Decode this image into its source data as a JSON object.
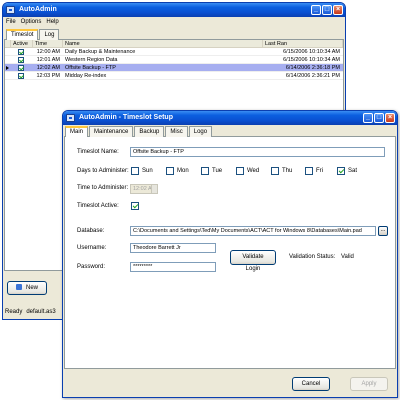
{
  "main_window": {
    "title": "AutoAdmin",
    "menu": [
      "File",
      "Options",
      "Help"
    ],
    "tabs": [
      "Timeslot",
      "Log"
    ],
    "grid": {
      "headers": [
        "Active",
        "Time",
        "Name",
        "Last Ran"
      ],
      "rows": [
        {
          "active": true,
          "time": "12:00 AM",
          "name": "Daily Backup & Maintenance",
          "last_ran": "6/15/2006 10:10:34 AM",
          "selected": false
        },
        {
          "active": true,
          "time": "12:01 AM",
          "name": "Western Region Data",
          "last_ran": "6/15/2006 10:10:34 AM",
          "selected": false
        },
        {
          "active": true,
          "time": "12:02 AM",
          "name": "Offsite Backup - FTP",
          "last_ran": "6/14/2006 2:36:18 PM",
          "selected": true
        },
        {
          "active": true,
          "time": "12:03 PM",
          "name": "Midday Re-index",
          "last_ran": "6/14/2006 2:36:21 PM",
          "selected": false
        }
      ]
    },
    "new_button": "New",
    "status": {
      "label": "Ready",
      "file": "default.as3"
    }
  },
  "setup_dialog": {
    "title": "AutoAdmin - Timeslot Setup",
    "tabs": [
      "Main",
      "Maintenance",
      "Backup",
      "Misc",
      "Logo"
    ],
    "timeslot_name_label": "Timeslot Name:",
    "timeslot_name": "Offsite Backup - FTP",
    "days_label": "Days to Administer:",
    "days": [
      {
        "label": "Sun",
        "checked": false
      },
      {
        "label": "Mon",
        "checked": false
      },
      {
        "label": "Tue",
        "checked": false
      },
      {
        "label": "Wed",
        "checked": false
      },
      {
        "label": "Thu",
        "checked": false
      },
      {
        "label": "Fri",
        "checked": false
      },
      {
        "label": "Sat",
        "checked": true
      }
    ],
    "time_label": "Time to Administer:",
    "time_value": "12:02 AM",
    "active_label": "Timeslot Active:",
    "active_checked": true,
    "database_label": "Database:",
    "database_value": "C:\\Documents and Settings\\Ted\\My Documents\\ACT\\ACT for Windows 8\\Databases\\Main.pad",
    "browse_label": "...",
    "username_label": "Username:",
    "username_value": "Theodore Barrett Jr",
    "password_label": "Password:",
    "password_value": "*********",
    "validate_button": "Validate Login",
    "validation_status_label": "Validation Status:",
    "validation_status_value": "Valid",
    "cancel_button": "Cancel",
    "apply_button": "Apply"
  }
}
